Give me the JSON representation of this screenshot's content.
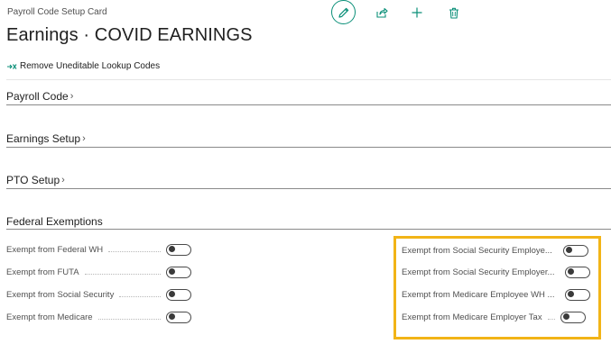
{
  "breadcrumb": "Payroll Code Setup Card",
  "title": "Earnings · COVID EARNINGS",
  "toolbar": {
    "edit": "edit-icon",
    "share": "share-icon",
    "add": "add-icon",
    "delete": "delete-icon"
  },
  "action": {
    "label": "Remove Uneditable Lookup Codes"
  },
  "sections": [
    {
      "label": "Payroll Code",
      "chevron": "›"
    },
    {
      "label": "Earnings Setup",
      "chevron": "›"
    },
    {
      "label": "PTO Setup",
      "chevron": "›"
    },
    {
      "label": "Federal Exemptions",
      "chevron": ""
    }
  ],
  "exemptions_left": [
    {
      "label": "Exempt from Federal WH",
      "on": false
    },
    {
      "label": "Exempt from FUTA",
      "on": false
    },
    {
      "label": "Exempt from Social Security",
      "on": false
    },
    {
      "label": "Exempt from Medicare",
      "on": false
    }
  ],
  "exemptions_right": [
    {
      "label": "Exempt from Social Security Employe...",
      "on": false
    },
    {
      "label": "Exempt from Social Security Employer...",
      "on": false
    },
    {
      "label": "Exempt from Medicare Employee WH ...",
      "on": false
    },
    {
      "label": "Exempt from Medicare Employer Tax",
      "on": false
    }
  ],
  "colors": {
    "accent": "#0a8f78",
    "highlight": "#f2b417"
  }
}
